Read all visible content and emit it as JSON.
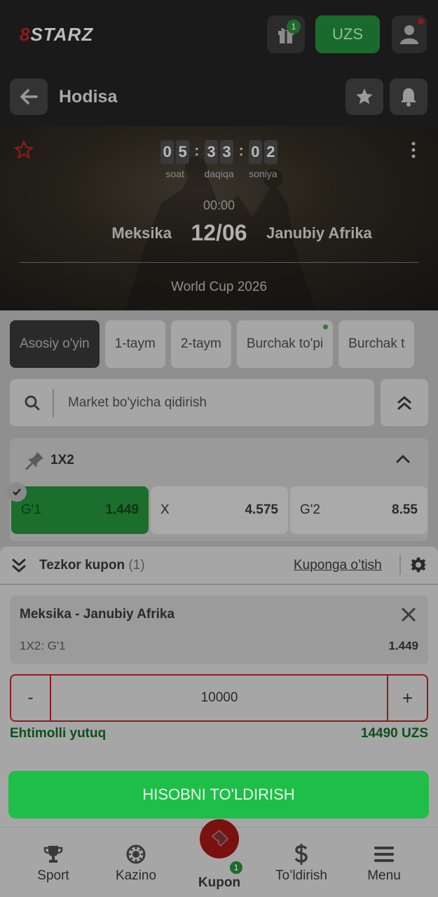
{
  "app": {
    "logo_text": "STARZ",
    "logo_prefix": "8",
    "currency": "UZS",
    "gift_badge": "1"
  },
  "header": {
    "title": "Hodisa"
  },
  "event": {
    "countdown": {
      "hours": [
        "0",
        "5"
      ],
      "minutes": [
        "3",
        "3"
      ],
      "seconds": [
        "0",
        "2"
      ],
      "hours_label": "soat",
      "minutes_label": "daqiqa",
      "seconds_label": "soniya"
    },
    "time": "00:00",
    "home_team": "Meksika",
    "date": "12/06",
    "away_team": "Janubiy Afrika",
    "tournament": "World Cup 2026"
  },
  "tabs": [
    {
      "label": "Asosiy o'yin",
      "active": true
    },
    {
      "label": "1-taym"
    },
    {
      "label": "2-taym"
    },
    {
      "label": "Burchak to'pi",
      "dot": true
    },
    {
      "label": "Burchak t"
    }
  ],
  "search": {
    "placeholder": "Market bo'yicha qidirish"
  },
  "market": {
    "title": "1X2",
    "odds": [
      {
        "label": "G'1",
        "value": "1.449",
        "selected": true
      },
      {
        "label": "X",
        "value": "4.575"
      },
      {
        "label": "G'2",
        "value": "8.55"
      }
    ]
  },
  "coupon": {
    "title": "Tezkor kupon",
    "count": "(1)",
    "goto_label": "Kuponga o’tish",
    "bet": {
      "match": "Meksika - Janubiy Afrika",
      "market": "1X2: G'1",
      "odd": "1.449"
    },
    "stake": {
      "minus": "-",
      "value": "10000",
      "plus": "+"
    },
    "potential_label": "Ehtimolli yutuq",
    "potential_value": "14490 UZS",
    "deposit_button": "HISOBNI TO'LDIRISH"
  },
  "bottom_nav": {
    "sport": "Sport",
    "casino": "Kazino",
    "coupon": "Kupon",
    "coupon_badge": "1",
    "deposit": "To’ldirish",
    "menu": "Menu"
  },
  "colors": {
    "accent_green": "#1fbe48",
    "brand_red": "#8c1d1d"
  }
}
